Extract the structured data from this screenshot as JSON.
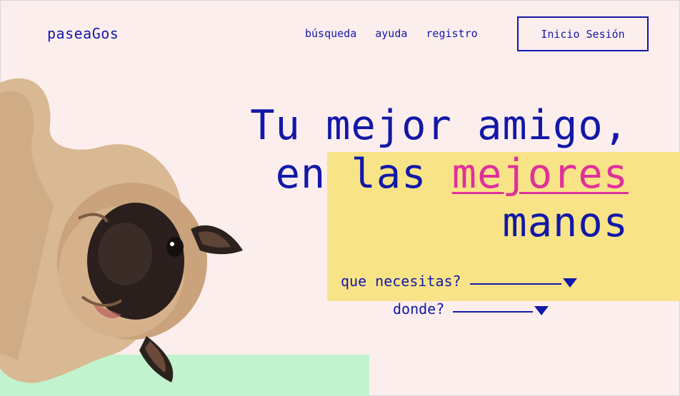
{
  "brand": "paseaGos",
  "nav": {
    "items": [
      "búsqueda",
      "ayuda",
      "registro"
    ],
    "login_label": "Inicio Sesión"
  },
  "hero": {
    "line1": "Tu mejor amigo,",
    "line2_prefix": "en las ",
    "line2_accent": "mejores",
    "line3": "manos"
  },
  "search": {
    "need_label": "que necesitas?",
    "where_label": "donde?"
  },
  "colors": {
    "background": "#fdeeee",
    "text": "#1218a8",
    "accent": "#e0309b",
    "yellow": "#f8e487",
    "green": "#c2f3cf"
  },
  "icons": [
    "pug-dog-image",
    "dropdown-caret-icon"
  ]
}
